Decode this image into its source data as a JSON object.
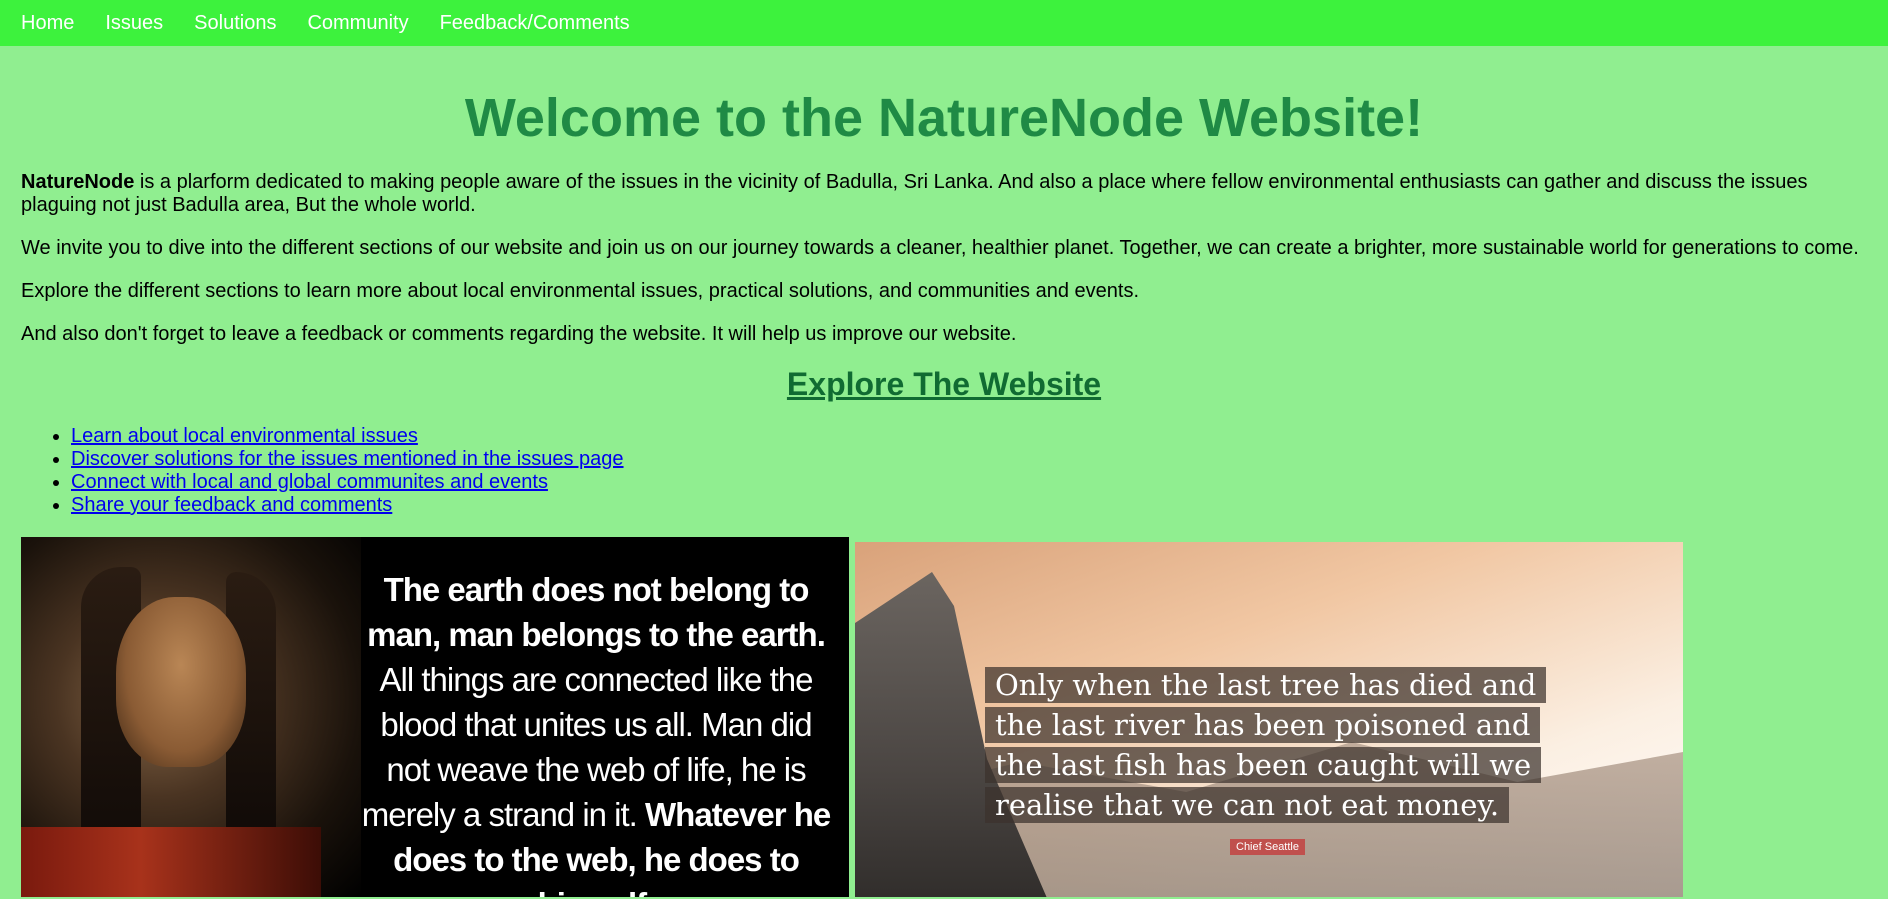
{
  "nav": {
    "items": [
      {
        "label": "Home"
      },
      {
        "label": "Issues"
      },
      {
        "label": "Solutions"
      },
      {
        "label": "Community"
      },
      {
        "label": "Feedback/Comments"
      }
    ]
  },
  "main": {
    "heading": "Welcome to the NatureNode Website!",
    "intro_brand": "NatureNode",
    "intro_rest": " is a plarform dedicated to making people aware of the issues in the vicinity of Badulla, Sri Lanka. And also a place where fellow environmental enthusiasts can gather and discuss the issues plaguing not just Badulla area, But the whole world.",
    "para2": "We invite you to dive into the different sections of our website and join us on our journey towards a cleaner, healthier planet. Together, we can create a brighter, more sustainable world for generations to come.",
    "para3": "Explore the different sections to learn more about local environmental issues, practical solutions, and communities and events.",
    "para4": "And also don't forget to leave a feedback or comments regarding the website. It will help us improve our website.",
    "explore_heading": "Explore The Website",
    "links": [
      {
        "label": "Learn about local environmental issues"
      },
      {
        "label": "Discover solutions for the issues mentioned in the issues page"
      },
      {
        "label": "Connect with local and global communites and events"
      },
      {
        "label": "Share your feedback and comments"
      }
    ]
  },
  "images": {
    "quote1": {
      "bold1": "The earth does not belong to man, man belongs to the earth.",
      "normal": "All things are connected like the blood that unites us all. Man did not weave the web of life, he is merely a strand in it.",
      "bold2": "Whatever he does to the web, he does to himself."
    },
    "quote2": {
      "lines": [
        "Only when the last tree has died and",
        "the last river has been poisoned and",
        "the last fish has been caught will we",
        "realise that we can not eat money."
      ],
      "attribution": "Chief Seattle"
    }
  }
}
